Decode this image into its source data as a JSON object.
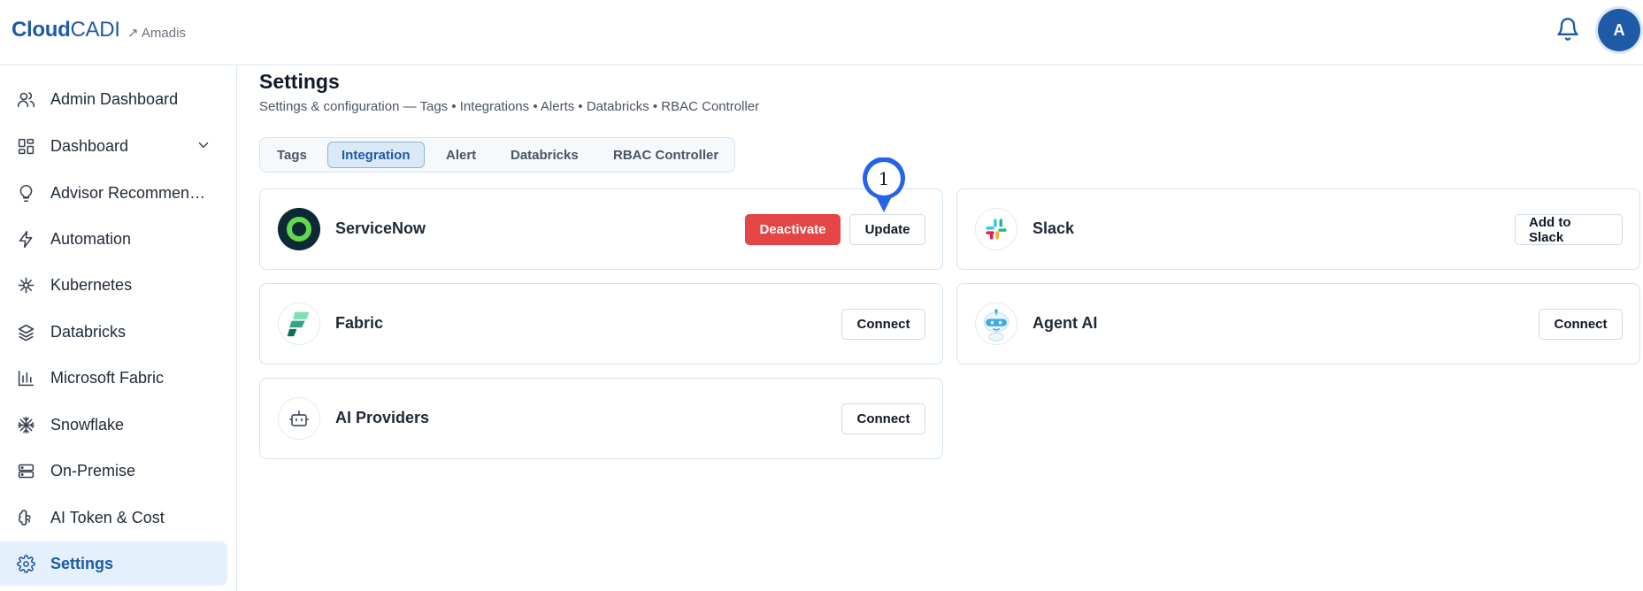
{
  "app": {
    "logo_bold": "Cloud",
    "logo_light": "CADI",
    "tenant": "↗ Amadis",
    "avatar_initial": "A",
    "accent_color": "#1e5aa8"
  },
  "sidebar": {
    "items": [
      {
        "label": "Admin Dashboard",
        "icon": "users-icon"
      },
      {
        "label": "Dashboard",
        "icon": "dashboard-grid-icon"
      },
      {
        "label": "Advisor Recommend...",
        "icon": "lightbulb-icon"
      },
      {
        "label": "Automation",
        "icon": "lightning-icon"
      },
      {
        "label": "Kubernetes",
        "icon": "kubernetes-icon"
      },
      {
        "label": "Databricks",
        "icon": "layers-icon"
      },
      {
        "label": "Microsoft Fabric",
        "icon": "bar-chart-icon"
      },
      {
        "label": "Snowflake",
        "icon": "snowflake-icon"
      },
      {
        "label": "On-Premise",
        "icon": "server-icon"
      },
      {
        "label": "AI Token & Cost",
        "icon": "brain-icon"
      },
      {
        "label": "Settings",
        "icon": "gear-icon",
        "active": true
      }
    ]
  },
  "page": {
    "title": "Settings",
    "subtitle": "Settings & configuration — Tags • Integrations • Alerts • Databricks • RBAC Controller"
  },
  "tabs": [
    {
      "label": "Tags"
    },
    {
      "label": "Integration",
      "active": true
    },
    {
      "label": "Alert"
    },
    {
      "label": "Databricks"
    },
    {
      "label": "RBAC Controller"
    }
  ],
  "integrations": {
    "servicenow": {
      "name": "ServiceNow",
      "deactivate_label": "Deactivate",
      "update_label": "Update"
    },
    "slack": {
      "name": "Slack",
      "action_label": "Add to Slack"
    },
    "fabric": {
      "name": "Fabric",
      "action_label": "Connect"
    },
    "agent_ai": {
      "name": "Agent AI",
      "action_label": "Connect"
    },
    "ai_providers": {
      "name": "AI Providers",
      "action_label": "Connect"
    }
  },
  "marker": {
    "number": "1",
    "color": "#2563eb"
  }
}
